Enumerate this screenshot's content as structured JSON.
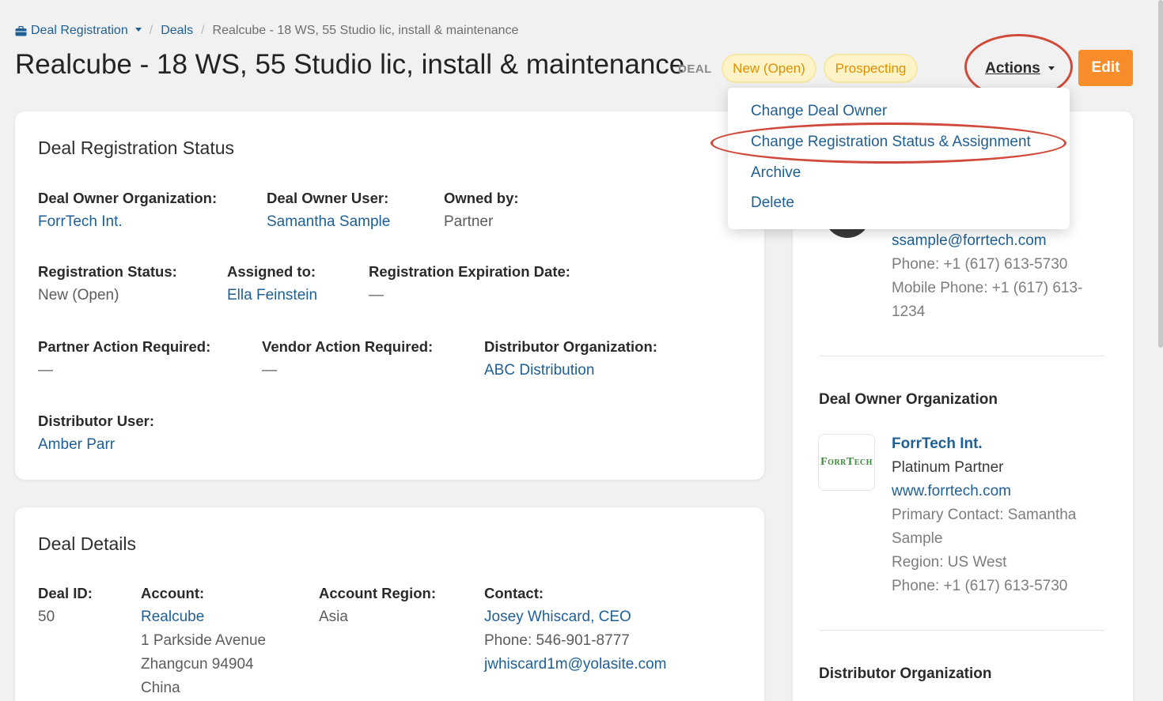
{
  "breadcrumb": {
    "root": "Deal Registration",
    "parent": "Deals",
    "current": "Realcube - 18 WS, 55 Studio lic, install & maintenance",
    "separator": "/"
  },
  "header": {
    "title": "Realcube - 18 WS, 55 Studio lic, install & maintenance",
    "type_tag": "DEAL",
    "status_pill": "New (Open)",
    "stage_pill": "Prospecting",
    "actions_label": "Actions",
    "edit_label": "Edit"
  },
  "actions_menu": {
    "items": [
      "Change Deal Owner",
      "Change Registration Status & Assignment",
      "Archive",
      "Delete"
    ]
  },
  "status_card": {
    "title": "Deal Registration Status",
    "deal_owner_org": {
      "label": "Deal Owner Organization:",
      "value": "ForrTech Int."
    },
    "deal_owner_user": {
      "label": "Deal Owner User:",
      "value": "Samantha Sample"
    },
    "owned_by": {
      "label": "Owned by:",
      "value": "Partner"
    },
    "registration_status": {
      "label": "Registration Status:",
      "value": "New (Open)"
    },
    "assigned_to": {
      "label": "Assigned to:",
      "value": "Ella Feinstein"
    },
    "expiration_date": {
      "label": "Registration Expiration Date:",
      "value": "—"
    },
    "partner_action": {
      "label": "Partner Action Required:",
      "value": "—"
    },
    "vendor_action": {
      "label": "Vendor Action Required:",
      "value": "—"
    },
    "distributor_org": {
      "label": "Distributor Organization:",
      "value": "ABC Distribution"
    },
    "distributor_user": {
      "label": "Distributor User:",
      "value": "Amber Parr"
    }
  },
  "details_card": {
    "title": "Deal Details",
    "deal_id": {
      "label": "Deal ID:",
      "value": "50"
    },
    "account": {
      "label": "Account:",
      "name": "Realcube",
      "address1": "1 Parkside Avenue",
      "address2": "Zhangcun 94904",
      "country": "China"
    },
    "account_region": {
      "label": "Account Region:",
      "value": "Asia"
    },
    "contact": {
      "label": "Contact:",
      "name": "Josey Whiscard, CEO",
      "phone": "Phone: 546-901-8777",
      "email": "jwhiscard1m@yolasite.com"
    }
  },
  "side_card": {
    "owner_email": "ssample@forrtech.com",
    "owner_phone": "Phone: +1 (617) 613-5730",
    "owner_mobile_1": "Mobile Phone: +1 (617) 613-",
    "owner_mobile_2": "1234",
    "org_heading": "Deal Owner Organization",
    "org_logo_text": "ForrTech",
    "org_name": "ForrTech Int.",
    "org_tier": "Platinum Partner",
    "org_website": "www.forrtech.com",
    "org_contact_1": "Primary Contact: Samantha",
    "org_contact_2": "Sample",
    "org_region": "Region: US West",
    "org_phone": "Phone: +1 (617) 613-5730",
    "distributor_heading": "Distributor Organization"
  },
  "colors": {
    "accent_orange": "#f78c2a",
    "link_blue": "#1f5f94",
    "pill_text": "#e09000",
    "annotation_red": "#cf4a3a"
  }
}
